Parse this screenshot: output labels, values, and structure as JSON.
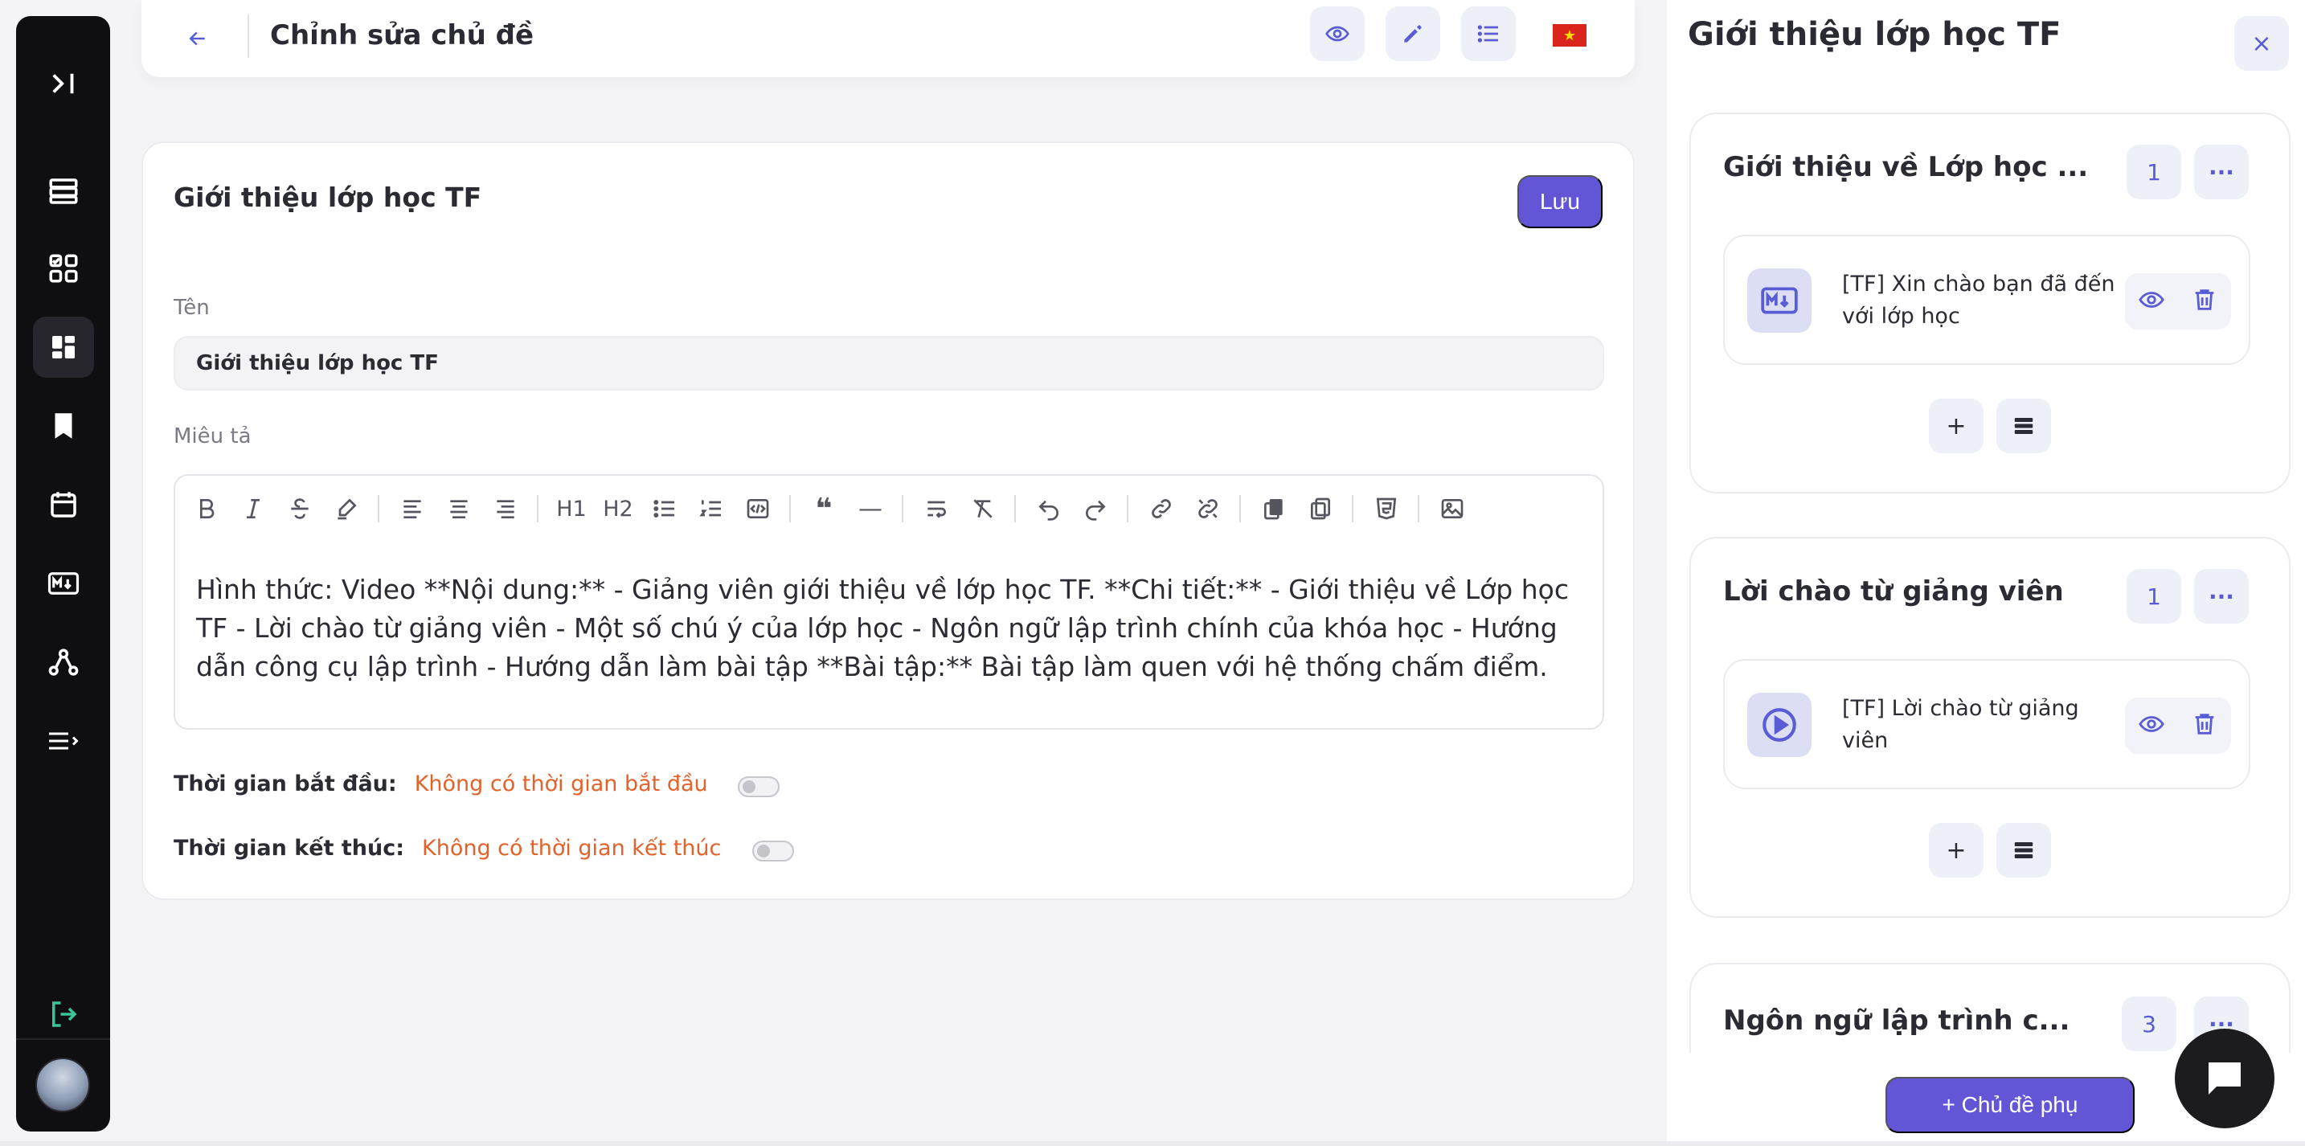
{
  "header": {
    "title": "Chỉnh sửa chủ đề"
  },
  "card": {
    "title": "Giới thiệu lớp học TF",
    "save_label": "Lưu",
    "name_label": "Tên",
    "name_value": "Giới thiệu lớp học TF",
    "description_label": "Miêu tả",
    "description_value": "Hình thức: Video **Nội dung:** - Giảng viên giới thiệu về lớp học TF. **Chi tiết:** - Giới thiệu về Lớp học TF - Lời chào từ giảng viên - Một số chú ý của lớp học - Ngôn ngữ lập trình chính của khóa học - Hướng dẫn công cụ lập trình - Hướng dẫn làm bài tập **Bài tập:** Bài tập làm quen với hệ thống chấm điểm.",
    "start_time_label": "Thời gian bắt đầu:",
    "start_time_value": "Không có thời gian bắt đầu",
    "end_time_label": "Thời gian kết thúc:",
    "end_time_value": "Không có thời gian kết thúc"
  },
  "toolbar": {
    "h1": "H1",
    "h2": "H2",
    "quote": "❝",
    "hr": "—"
  },
  "right_panel": {
    "title": "Giới thiệu lớp học TF",
    "close": "×",
    "sections": [
      {
        "title": "Giới thiệu về Lớp học ...",
        "count": "1",
        "more": "···",
        "lesson": "[TF] Xin chào bạn đã đến với lớp học",
        "lesson_icon": "markdown-icon"
      },
      {
        "title": "Lời chào từ giảng viên",
        "count": "1",
        "more": "···",
        "lesson": "[TF] Lời chào từ giảng viên",
        "lesson_icon": "play-icon"
      },
      {
        "title": "Ngôn ngữ lập trình c...",
        "count": "3",
        "more": "···"
      }
    ],
    "add_plus": "+",
    "add_subtopic": "+   Chủ đề phụ"
  },
  "colors": {
    "accent": "#6256d6",
    "warning_text": "#e2622b",
    "sidebar_bg": "#0f0f12"
  }
}
